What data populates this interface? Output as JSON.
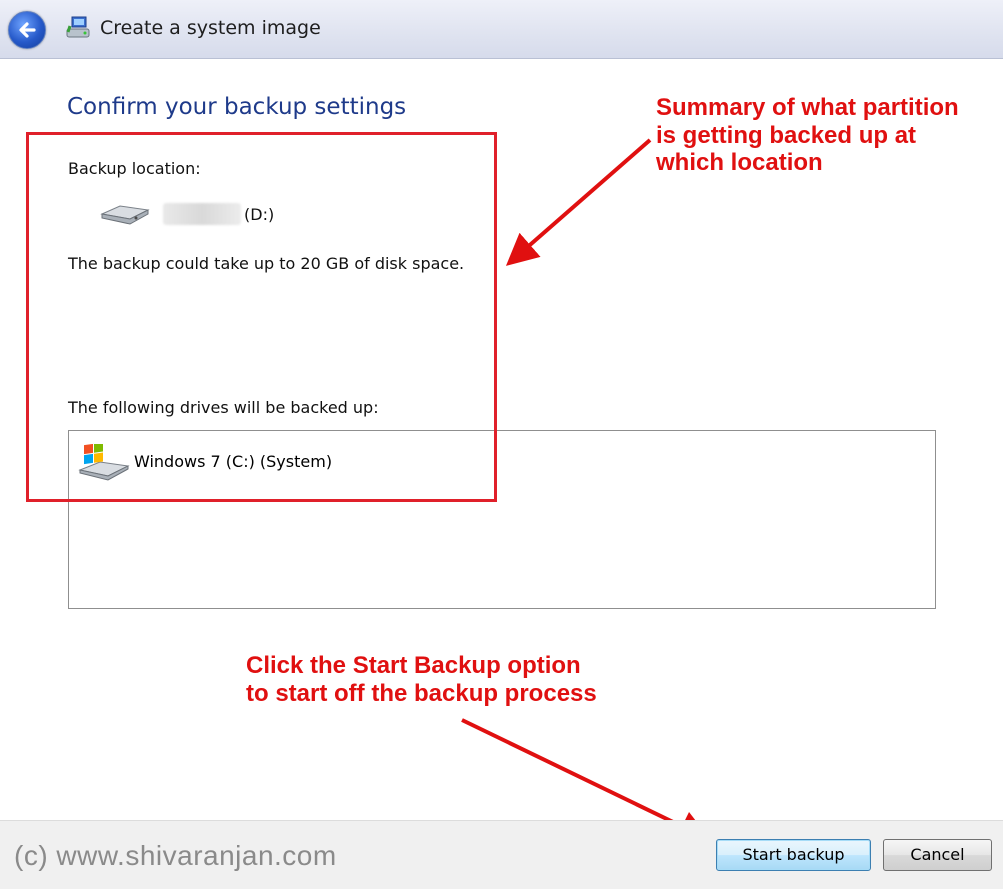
{
  "window": {
    "title": "Create a system image"
  },
  "page": {
    "heading": "Confirm your backup settings",
    "backup_location_label": "Backup location:",
    "backup_drive_letter": "(D:)",
    "space_note": "The backup could take up to 20 GB of disk space.",
    "drives_label": "The following drives will be backed up:",
    "drives": [
      "Windows 7 (C:) (System)"
    ]
  },
  "buttons": {
    "start_backup": "Start backup",
    "cancel": "Cancel"
  },
  "annotations": {
    "summary_lines": [
      "Summary of what partition",
      "is getting backed up at",
      "which location"
    ],
    "start_lines": [
      "Click the Start Backup option",
      "to start off the backup process"
    ]
  },
  "watermark": "(c) www.shivaranjan.com",
  "colors": {
    "annotation_red": "#e01010",
    "heading_blue": "#1e3a8a"
  },
  "icons": [
    "back-arrow-icon",
    "system-image-icon",
    "drive-icon",
    "windows-drive-icon"
  ]
}
